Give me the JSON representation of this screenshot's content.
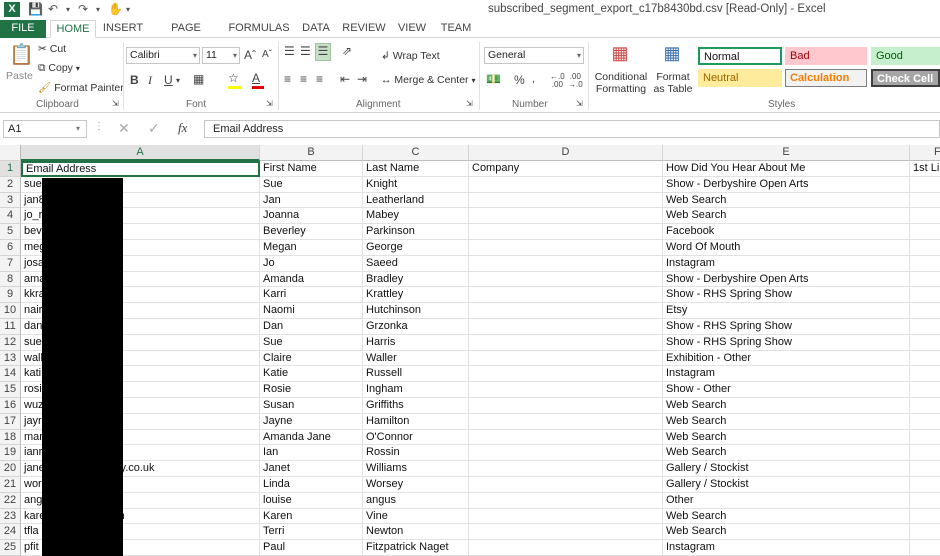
{
  "app": {
    "title": "subscribed_segment_export_c17b8430bd.csv  [Read-Only] - Excel",
    "logo": "X",
    "accent": "#217346"
  },
  "tabs": [
    "FILE",
    "HOME",
    "INSERT",
    "PAGE LAYOUT",
    "FORMULAS",
    "DATA",
    "REVIEW",
    "VIEW",
    "TEAM"
  ],
  "ribbon": {
    "clipboard": {
      "paste": "Paste",
      "cut": "Cut",
      "copy": "Copy",
      "format_painter": "Format Painter",
      "label": "Clipboard"
    },
    "font": {
      "name": "Calibri",
      "size": "11",
      "bold": "B",
      "italic": "I",
      "underline": "U",
      "label": "Font"
    },
    "alignment": {
      "wrap_text": "Wrap Text",
      "merge_center": "Merge & Center",
      "label": "Alignment"
    },
    "number": {
      "format": "General",
      "label": "Number"
    },
    "styles": {
      "conditional_formatting": "Conditional Formatting",
      "format_as_table": "Format as Table",
      "normal": "Normal",
      "bad": "Bad",
      "good": "Good",
      "neutral": "Neutral",
      "calculation": "Calculation",
      "check_cell": "Check Cell",
      "label": "Styles"
    }
  },
  "formula_bar": {
    "name_box": "A1",
    "fx": "fx",
    "content": "Email Address"
  },
  "columns": [
    "A",
    "B",
    "C",
    "D",
    "E",
    "F"
  ],
  "headers": [
    "Email Address",
    "First Name",
    "Last Name",
    "Company",
    "How Did You Hear About Me",
    "1st Lin"
  ],
  "rows": [
    {
      "n": "2",
      "email": "sue                .co.uk",
      "first": "Sue",
      "last": "Knight",
      "how": "Show - Derbyshire Open Arts"
    },
    {
      "n": "3",
      "email": "jan8",
      "first": "Jan",
      "last": "Leatherland",
      "how": "Web Search"
    },
    {
      "n": "4",
      "email": "jo_r                    om",
      "first": "Joanna",
      "last": "Mabey",
      "how": "Web Search"
    },
    {
      "n": "5",
      "email": "bev               21.com",
      "first": "Beverley",
      "last": "Parkinson",
      "how": "Facebook"
    },
    {
      "n": "6",
      "email": "meg               nail.com",
      "first": "Megan",
      "last": "George",
      "how": "Word Of Mouth"
    },
    {
      "n": "7",
      "email": "josa                    o.uk",
      "first": "Jo",
      "last": "Saeed",
      "how": "Instagram"
    },
    {
      "n": "8",
      "email": "ama               mail.com",
      "first": "Amanda",
      "last": "Bradley",
      "how": "Show - Derbyshire Open Arts"
    },
    {
      "n": "9",
      "email": "kkra                   m",
      "first": "Karri",
      "last": "Krattley",
      "how": "Show - RHS Spring Show"
    },
    {
      "n": "10",
      "email": "nair                il.com",
      "first": "Naomi",
      "last": "Hutchinson",
      "how": "Etsy"
    },
    {
      "n": "11",
      "email": "dan",
      "first": "Dan",
      "last": "Grzonka",
      "how": "Show - RHS Spring Show"
    },
    {
      "n": "12",
      "email": "sue",
      "first": "Sue",
      "last": "Harris",
      "how": "Show - RHS Spring Show"
    },
    {
      "n": "13",
      "email": "wall                 il.com",
      "first": "Claire",
      "last": "Waller",
      "how": "Exhibition - Other"
    },
    {
      "n": "14",
      "email": "kati                 .com",
      "first": "Katie",
      "last": "Russell",
      "how": "Instagram"
    },
    {
      "n": "15",
      "email": "rosi",
      "first": "Rosie",
      "last": "Ingham",
      "how": "Show - Other"
    },
    {
      "n": "16",
      "email": "wuz",
      "first": "Susan",
      "last": "Griffiths",
      "how": "Web Search"
    },
    {
      "n": "17",
      "email": "jayr",
      "first": "Jayne",
      "last": "Hamilton",
      "how": "Web Search"
    },
    {
      "n": "18",
      "email": "mar                    om",
      "first": "Amanda Jane",
      "last": "O'Connor",
      "how": "Web Search"
    },
    {
      "n": "19",
      "email": "ianr",
      "first": "Ian",
      "last": "Rossin",
      "how": "Web Search"
    },
    {
      "n": "20",
      "email": "jane                  etgallery.co.uk",
      "first": "Janet",
      "last": "Williams",
      "how": "Gallery / Stockist"
    },
    {
      "n": "21",
      "email": "wor                    om",
      "first": "Linda",
      "last": "Worsey",
      "how": "Gallery / Stockist"
    },
    {
      "n": "22",
      "email": "ang                    .com",
      "first": "louise",
      "last": "angus",
      "how": "Other"
    },
    {
      "n": "23",
      "email": "kare                mail.com",
      "first": "Karen",
      "last": "Vine",
      "how": "Web Search"
    },
    {
      "n": "24",
      "email": "tfla                   et",
      "first": "Terri",
      "last": "Newton",
      "how": "Web Search"
    },
    {
      "n": "25",
      "email": "pfit                   et",
      "first": "Paul",
      "last": "Fitzpatrick Naget",
      "how": "Instagram"
    }
  ]
}
